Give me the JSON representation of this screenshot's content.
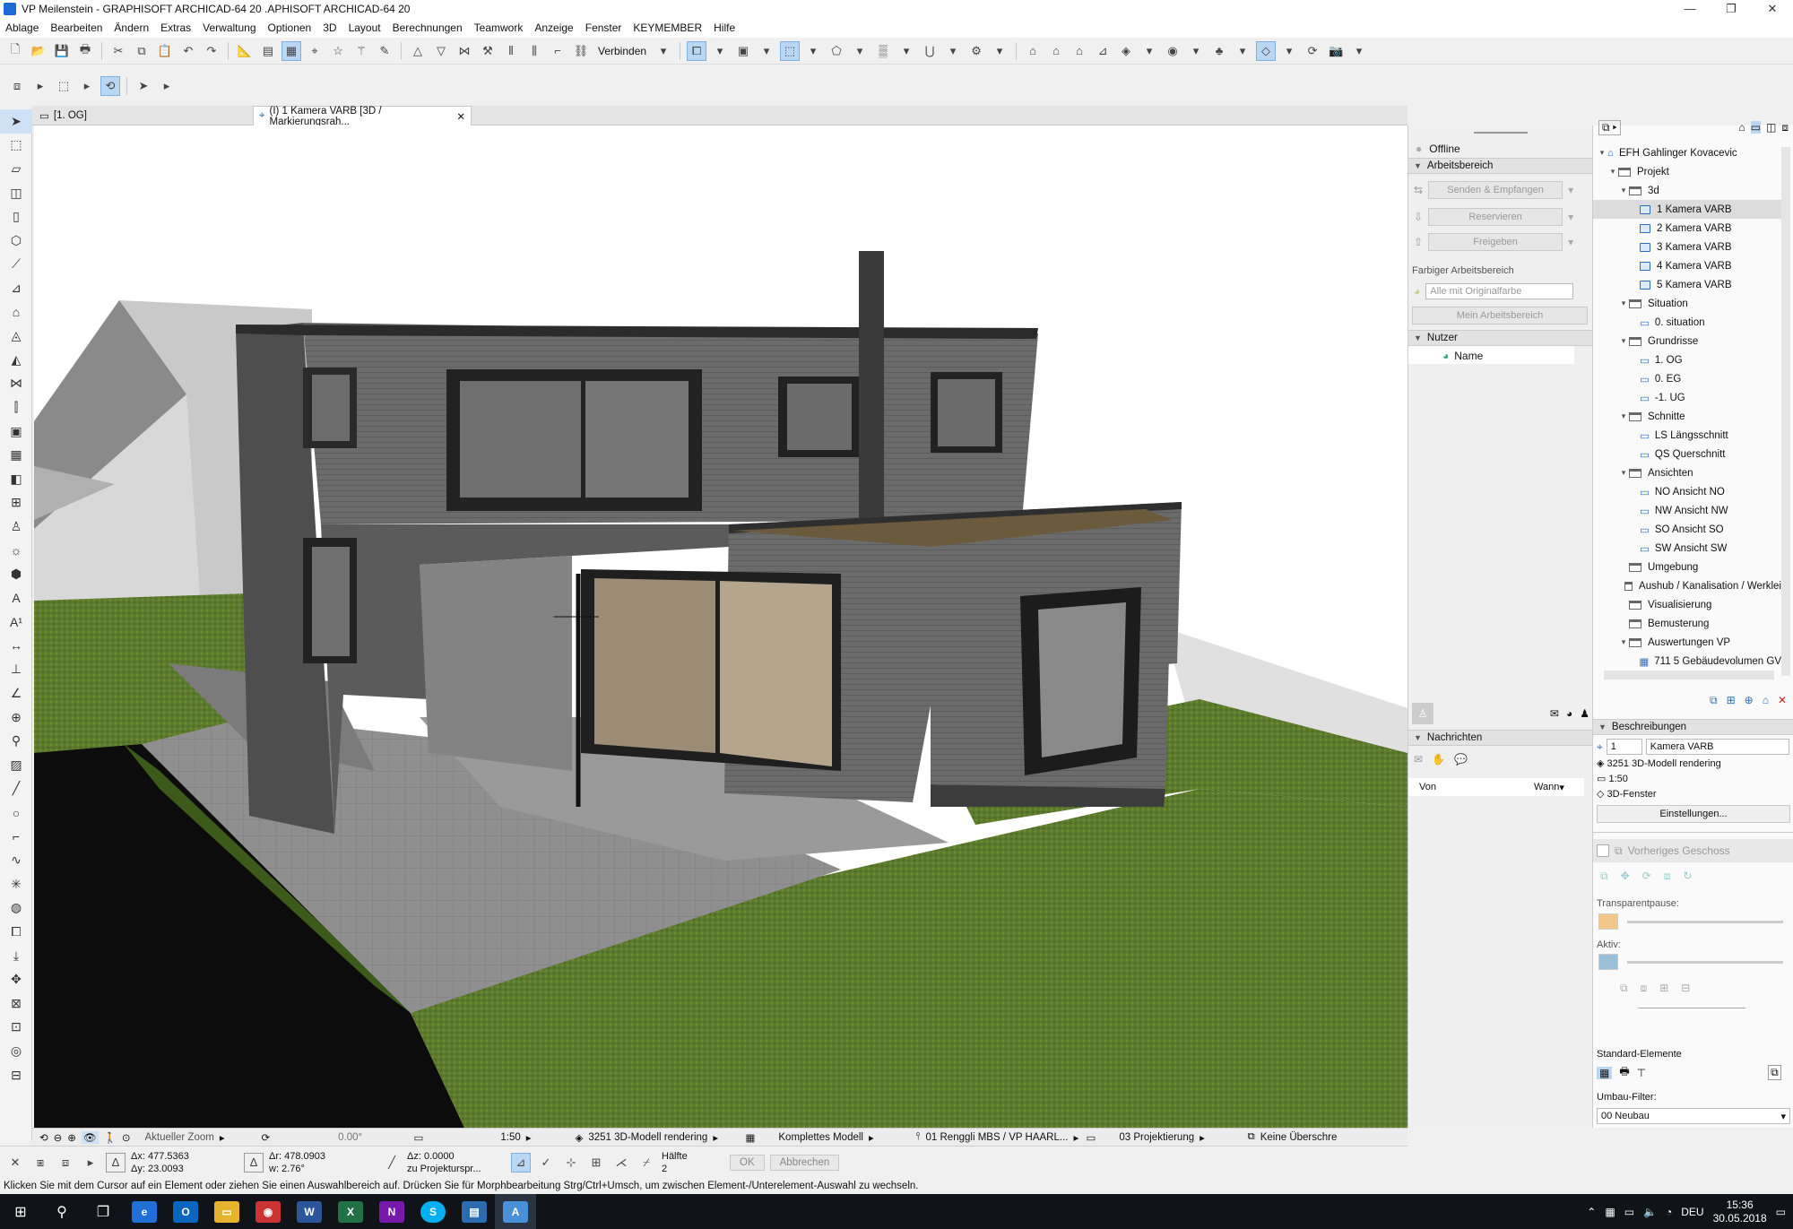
{
  "window": {
    "title": "VP Meilenstein - GRAPHISOFT ARCHICAD-64 20 .APHISOFT ARCHICAD-64 20"
  },
  "menu": [
    "Ablage",
    "Bearbeiten",
    "Ändern",
    "Extras",
    "Verwaltung",
    "Optionen",
    "3D",
    "Layout",
    "Berechnungen",
    "Teamwork",
    "Anzeige",
    "Fenster",
    "KEYMEMBER",
    "Hilfe"
  ],
  "toolbar": {
    "connect_label": "Verbinden"
  },
  "tabs": {
    "floor": "[1. OG]",
    "camera": "(I) 1 Kamera VARB [3D / Markierungsrah..."
  },
  "teamwork": {
    "status": "Offline",
    "workspace_header": "Arbeitsbereich",
    "send_receive": "Senden & Empfangen",
    "reserve": "Reservieren",
    "release": "Freigeben",
    "colored_workspace_label": "Farbiger Arbeitsbereich",
    "color_option": "Alle mit Originalfarbe",
    "my_workspace": "Mein Arbeitsbereich",
    "users_header": "Nutzer",
    "name_col": "Name",
    "messages_header": "Nachrichten",
    "from_col": "Von",
    "when_col": "Wann"
  },
  "navigator": {
    "tree": [
      {
        "label": "EFH Gahlinger Kovacevic",
        "level": 0,
        "kind": "project"
      },
      {
        "label": "Projekt",
        "level": 1,
        "kind": "folder"
      },
      {
        "label": "3d",
        "level": 2,
        "kind": "folder"
      },
      {
        "label": "1 Kamera VARB",
        "level": 3,
        "kind": "camera",
        "selected": true
      },
      {
        "label": "2 Kamera VARB",
        "level": 3,
        "kind": "camera"
      },
      {
        "label": "3 Kamera VARB",
        "level": 3,
        "kind": "camera"
      },
      {
        "label": "4 Kamera VARB",
        "level": 3,
        "kind": "camera"
      },
      {
        "label": "5 Kamera VARB",
        "level": 3,
        "kind": "camera"
      },
      {
        "label": "Situation",
        "level": 2,
        "kind": "folder"
      },
      {
        "label": "0. situation",
        "level": 3,
        "kind": "view"
      },
      {
        "label": "Grundrisse",
        "level": 2,
        "kind": "folder"
      },
      {
        "label": "1. OG",
        "level": 3,
        "kind": "view"
      },
      {
        "label": "0. EG",
        "level": 3,
        "kind": "view"
      },
      {
        "label": "-1. UG",
        "level": 3,
        "kind": "view"
      },
      {
        "label": "Schnitte",
        "level": 2,
        "kind": "folder"
      },
      {
        "label": "LS Längsschnitt",
        "level": 3,
        "kind": "view"
      },
      {
        "label": "QS Querschnitt",
        "level": 3,
        "kind": "view"
      },
      {
        "label": "Ansichten",
        "level": 2,
        "kind": "folder"
      },
      {
        "label": "NO Ansicht NO",
        "level": 3,
        "kind": "view"
      },
      {
        "label": "NW Ansicht NW",
        "level": 3,
        "kind": "view"
      },
      {
        "label": "SO Ansicht SO",
        "level": 3,
        "kind": "view"
      },
      {
        "label": "SW Ansicht SW",
        "level": 3,
        "kind": "view"
      },
      {
        "label": "Umgebung",
        "level": 2,
        "kind": "folder"
      },
      {
        "label": "Aushub / Kanalisation / Werklei",
        "level": 2,
        "kind": "folder"
      },
      {
        "label": "Visualisierung",
        "level": 2,
        "kind": "folder"
      },
      {
        "label": "Bemusterung",
        "level": 2,
        "kind": "folder"
      },
      {
        "label": "Auswertungen VP",
        "level": 2,
        "kind": "folder"
      },
      {
        "label": "711 5 Gebäudevolumen GV",
        "level": 3,
        "kind": "list"
      }
    ],
    "descriptions_header": "Beschreibungen",
    "id_value": "1",
    "name_value": "Kamera VARB",
    "line1": "3251 3D-Modell rendering",
    "line2": "1:50",
    "line3": "3D-Fenster",
    "settings_btn": "Einstellungen...",
    "prev_floor": "Vorheriges Geschoss",
    "transparent_label": "Transparentpause:",
    "active_label": "Aktiv:",
    "standard_label": "Standard-Elemente",
    "renovation_label": "Umbau-Filter:",
    "renovation_value": "00 Neubau"
  },
  "vpbar": {
    "zoom": "Aktueller Zoom",
    "angle": "0.00°",
    "scale": "1:50",
    "layer": "3251 3D-Modell rendering",
    "model": "Komplettes Modell",
    "pen": "01 Renggli MBS / VP HAARL...",
    "dim": "03 Projektierung",
    "override": "Keine Überschre"
  },
  "infobar": {
    "dx": "Δx: 477.5363",
    "dy": "Δy: 23.0093",
    "dr": "Δr: 478.0903",
    "w": "w: 2.76°",
    "dz": "Δz: 0.0000",
    "ref": "zu Projekturspr...",
    "half": "Hälfte",
    "half_num": "2",
    "ok": "OK",
    "cancel": "Abbrechen"
  },
  "statusline": "Klicken Sie mit dem Cursor auf ein Element oder ziehen Sie einen Auswahlbereich auf. Drücken Sie für Morphbearbeitung Strg/Ctrl+Umsch, um zwischen Element-/Unterelement-Auswahl zu wechseln.",
  "taskbar": {
    "lang": "DEU",
    "time": "15:36",
    "date": "30.05.2018"
  },
  "colors": {
    "accent": "#1e6bd6",
    "selection": "#b9d6f3",
    "grass": "#5c7a2a",
    "facade": "#6a6a6a",
    "taskbar": "#101418"
  }
}
